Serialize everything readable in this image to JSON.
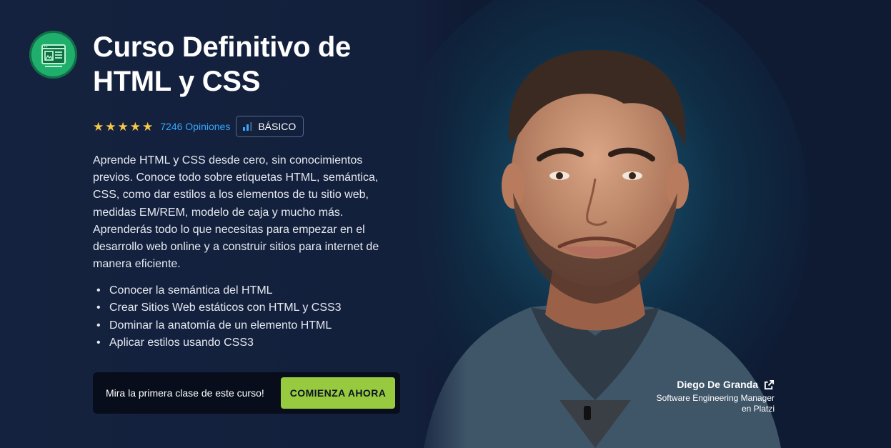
{
  "course": {
    "title": "Curso Definitivo de HTML y CSS",
    "badge_icon": "html-css-course-icon",
    "rating_stars": 5,
    "reviews": "7246 Opiniones",
    "level": "BÁSICO",
    "description": "Aprende HTML y CSS desde cero, sin conocimientos previos. Conoce todo sobre etiquetas HTML, semántica, CSS, como dar estilos a los elementos de tu sitio web, medidas EM/REM, modelo de caja y mucho más. Aprenderás todo lo que necesitas para empezar en el desarrollo web online y a construir sitios para internet de manera eficiente.",
    "bullets": [
      "Conocer la semántica del HTML",
      "Crear Sitios Web estáticos con HTML y CSS3",
      "Dominar la anatomía de un elemento HTML",
      "Aplicar estilos usando CSS3"
    ]
  },
  "cta": {
    "text": "Mira la primera clase de este curso!",
    "button_label": "COMIENZA AHORA"
  },
  "instructor": {
    "name": "Diego De Granda",
    "role": "Software Engineering Manager en Platzi",
    "link_icon": "external-link-icon"
  },
  "colors": {
    "background": "#13213f",
    "accent_green": "#98ca3f",
    "link_blue": "#33a8ff",
    "star_yellow": "#f7c948",
    "badge_green": "#1fae6b"
  }
}
